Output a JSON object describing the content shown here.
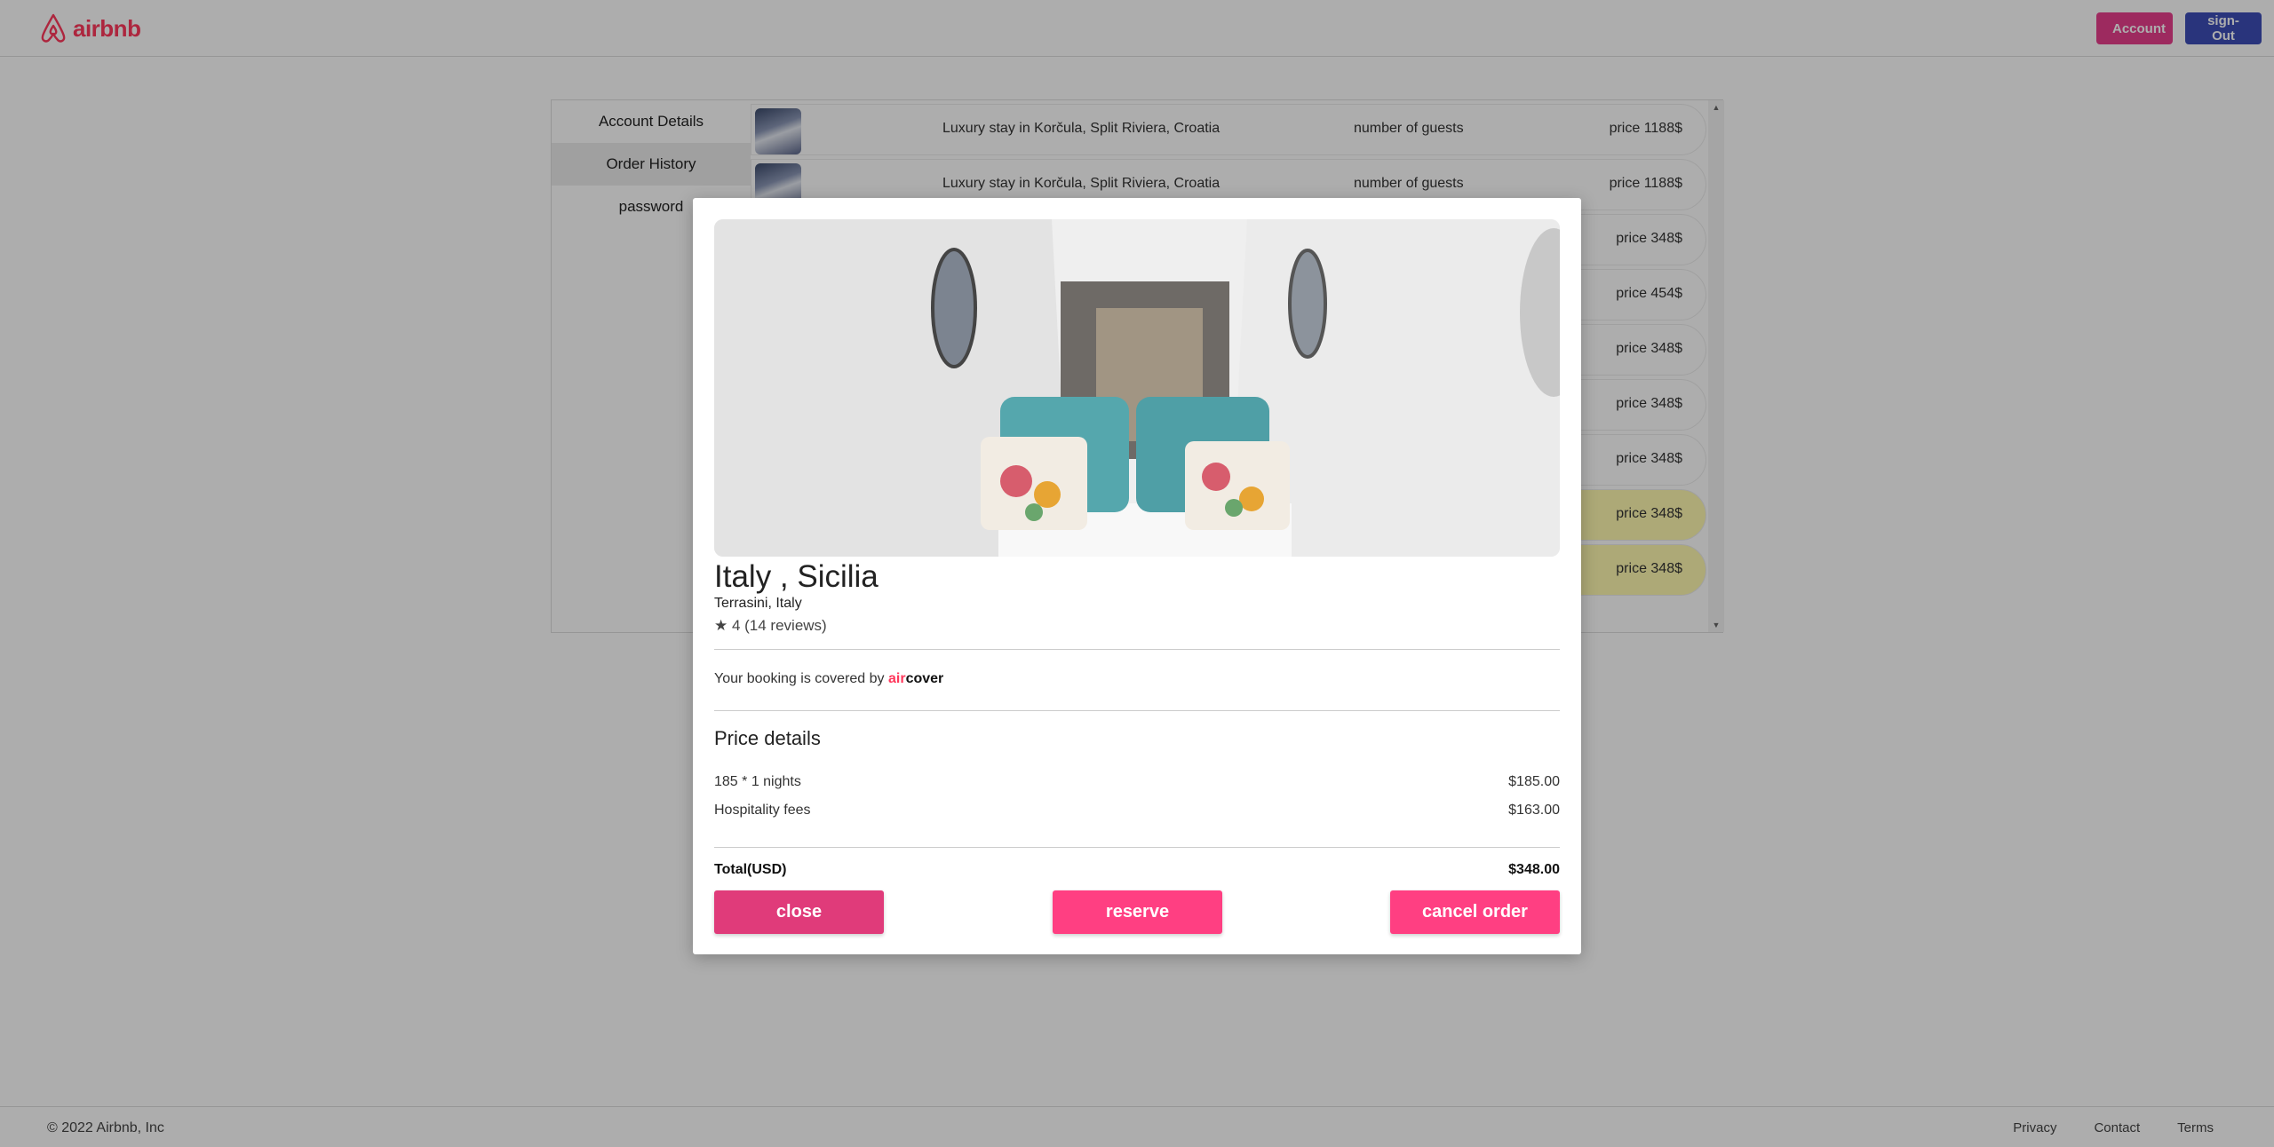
{
  "header": {
    "logo_text": "airbnb",
    "account_label": "Account",
    "signout_label": "sign-Out"
  },
  "sidebar": {
    "items": [
      {
        "label": "Account Details"
      },
      {
        "label": "Order History"
      },
      {
        "label": "password"
      }
    ]
  },
  "orders": [
    {
      "title": "Luxury stay in Korčula, Split Riviera, Croatia",
      "guests": "number of guests",
      "price": "price 1188$"
    },
    {
      "title": "Luxury stay in Korčula, Split Riviera, Croatia",
      "guests": "number of guests",
      "price": "price 1188$"
    },
    {
      "title": "",
      "guests": "",
      "price": "price 348$"
    },
    {
      "title": "",
      "guests": "",
      "price": "price 454$"
    },
    {
      "title": "",
      "guests": "",
      "price": "price 348$"
    },
    {
      "title": "",
      "guests": "",
      "price": "price 348$"
    },
    {
      "title": "",
      "guests": "",
      "price": "price 348$"
    },
    {
      "title": "",
      "guests": "",
      "price": "price 348$"
    },
    {
      "title": "",
      "guests": "",
      "price": "price 348$"
    }
  ],
  "footer": {
    "copyright": "© 2022 Airbnb, Inc",
    "links": [
      "Privacy",
      "Contact",
      "Terms"
    ]
  },
  "modal": {
    "title": "Italy , Sicilia",
    "location": "Terrasini, Italy",
    "rating": "★ 4 (14 reviews)",
    "aircover_text": "Your booking is covered by",
    "aircover_air": "air",
    "aircover_cover": "cover",
    "price_heading": "Price details",
    "nights_label": "185 * 1 nights",
    "nights_value": "$185.00",
    "fees_label": "Hospitality fees",
    "fees_value": "$163.00",
    "total_label": "Total(USD)",
    "total_value": "$348.00",
    "close_label": "close",
    "reserve_label": "reserve",
    "cancel_label": "cancel order"
  },
  "colors": {
    "brand": "#ff385c",
    "account_button": "#e83e8c",
    "signout_button": "#3d4db7",
    "modal_button": "#ff3f82",
    "highlight_row": "#fff9b0"
  }
}
